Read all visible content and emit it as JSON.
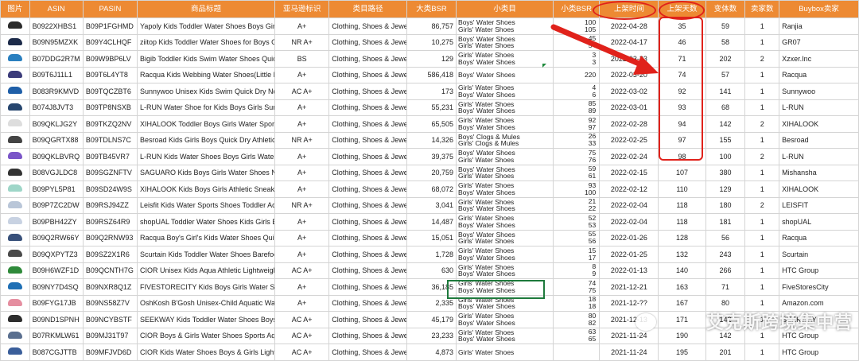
{
  "headers": [
    "图片",
    "ASIN",
    "PASIN",
    "商品标题",
    "亚马逊标识",
    "类目路径",
    "大类BSR",
    "小类目",
    "小类BSR",
    "上架时间",
    "上架天数",
    "变体数",
    "卖家数",
    "Buybox卖家"
  ],
  "colors": {
    "header_bg": "#ed8a33",
    "annotation_red": "#e0221b",
    "selection_green": "#1e7a3c"
  },
  "rows": [
    {
      "shoe": "#2b2b2b",
      "asin": "B0922XHBS1",
      "pasin": "B09P1FGHMD",
      "title": "Yapoly Kids Toddler Water Shoes Boys Girls Toddler",
      "badge": "A+",
      "cat": "Clothing, Shoes & Jewelry",
      "bsr": "86,757",
      "sub1": "Boys' Water Shoes",
      "sub2": "Girls' Water Shoes",
      "sbsr1": "100",
      "sbsr2": "105",
      "date": "2022-04-28",
      "days": "35",
      "var": "59",
      "sellers": "1",
      "buybox": "Ranjia"
    },
    {
      "shoe": "#1d2b4a",
      "asin": "B09N95MZXK",
      "pasin": "B09Y4CLHQF",
      "title": "ziitop Kids Toddler Water Shoes for Boys Girls",
      "badge": "NR A+",
      "cat": "Clothing, Shoes & Jewelry",
      "bsr": "10,275",
      "sub1": "Boys' Water Shoes",
      "sub2": "Girls' Water Shoes",
      "sbsr1": "45",
      "sbsr2": "54",
      "date": "2022-04-17",
      "days": "46",
      "var": "58",
      "sellers": "1",
      "buybox": "GR07"
    },
    {
      "shoe": "#2a7fbf",
      "asin": "B07DDG2R7M",
      "pasin": "B09W9BP6LV",
      "title": "Bigib Toddler Kids Swim Water Shoes Quick Dry",
      "badge": "BS",
      "cat": "Clothing, Shoes & Jewelry",
      "bsr": "129",
      "sub1": "Girls' Water Shoes",
      "sub2": "Boys' Water Shoes",
      "sbsr1": "3",
      "sbsr2": "3",
      "date": "2022-03-23",
      "days": "71",
      "var": "202",
      "sellers": "2",
      "buybox": "Xzxer.Inc"
    },
    {
      "shoe": "#3b3b7a",
      "asin": "B09T6J11L1",
      "pasin": "B09T6L4YT8",
      "title": "Racqua Kids Webbing Water Shoes(Little Kid/Big Kid)",
      "badge": "A+",
      "cat": "Clothing, Shoes & Jewelry",
      "bsr": "586,418",
      "sub1": "Boys' Water Shoes",
      "sub2": "",
      "sbsr1": "220",
      "sbsr2": "",
      "date": "2022-03-20",
      "days": "74",
      "var": "57",
      "sellers": "1",
      "buybox": "Racqua"
    },
    {
      "shoe": "#1f5fa8",
      "asin": "B083R9KMVD",
      "pasin": "B09TQCZBT6",
      "title": "Sunnywoo Unisex Kids Swim Quick Dry Non-Slip",
      "badge": "AC A+",
      "cat": "Clothing, Shoes & Jewelry",
      "bsr": "173",
      "sub1": "Girls' Water Shoes",
      "sub2": "Boys' Water Shoes",
      "sbsr1": "4",
      "sbsr2": "6",
      "date": "2022-03-02",
      "days": "92",
      "var": "141",
      "sellers": "1",
      "buybox": "Sunnywoo"
    },
    {
      "shoe": "#26456e",
      "asin": "B074J8JVT3",
      "pasin": "B09TP8NSXB",
      "title": "L-RUN Water Shoe for Kids Boys Girls Summer",
      "badge": "A+",
      "cat": "Clothing, Shoes & Jewelry",
      "bsr": "55,231",
      "sub1": "Girls' Water Shoes",
      "sub2": "Boys' Water Shoes",
      "sbsr1": "85",
      "sbsr2": "89",
      "date": "2022-03-01",
      "days": "93",
      "var": "68",
      "sellers": "1",
      "buybox": "L-RUN"
    },
    {
      "shoe": "#dddddd",
      "asin": "B09QKLJG2Y",
      "pasin": "B09TKZQ2NV",
      "title": "XIHALOOK Toddler Boys Girls Water Sport Shoes",
      "badge": "A+",
      "cat": "Clothing, Shoes & Jewelry",
      "bsr": "65,505",
      "sub1": "Girls' Water Shoes",
      "sub2": "Boys' Water Shoes",
      "sbsr1": "92",
      "sbsr2": "97",
      "date": "2022-02-28",
      "days": "94",
      "var": "142",
      "sellers": "2",
      "buybox": "XIHALOOK"
    },
    {
      "shoe": "#444444",
      "asin": "B09QGRTX88",
      "pasin": "B09TDLNS7C",
      "title": "Besroad Kids Girls Boys Quick Dry Athletic Shoes",
      "badge": "NR A+",
      "cat": "Clothing, Shoes & Jewelry",
      "bsr": "14,326",
      "sub1": "Boys' Clogs & Mules",
      "sub2": "Girls' Clogs & Mules",
      "sbsr1": "26",
      "sbsr2": "33",
      "date": "2022-02-25",
      "days": "97",
      "var": "155",
      "sellers": "1",
      "buybox": "Besroad"
    },
    {
      "shoe": "#7a55c8",
      "asin": "B09QKLBVRQ",
      "pasin": "B09TB45VR7",
      "title": "L-RUN Kids Water Shoes Boys Girls Water Barefoot",
      "badge": "A+",
      "cat": "Clothing, Shoes & Jewelry",
      "bsr": "39,375",
      "sub1": "Boys' Water Shoes",
      "sub2": "Girls' Water Shoes",
      "sbsr1": "75",
      "sbsr2": "76",
      "date": "2022-02-24",
      "days": "98",
      "var": "100",
      "sellers": "2",
      "buybox": "L-RUN"
    },
    {
      "shoe": "#333333",
      "asin": "B08VGJLDC8",
      "pasin": "B09SGZNFTV",
      "title": "SAGUARO Kids Boys Girls Water Shoes Non-Slip",
      "badge": "A+",
      "cat": "Clothing, Shoes & Jewelry",
      "bsr": "20,759",
      "sub1": "Boys' Water Shoes",
      "sub2": "Girls' Water Shoes",
      "sbsr1": "59",
      "sbsr2": "61",
      "date": "2022-02-15",
      "days": "107",
      "var": "380",
      "sellers": "1",
      "buybox": "Mishansha"
    },
    {
      "shoe": "#9ed6c8",
      "asin": "B09PYL5P81",
      "pasin": "B09SD24W9S",
      "title": "XIHALOOK Kids Boys Girls Athletic Sneakers Water",
      "badge": "A+",
      "cat": "Clothing, Shoes & Jewelry",
      "bsr": "68,072",
      "sub1": "Girls' Water Shoes",
      "sub2": "Boys' Water Shoes",
      "sbsr1": "93",
      "sbsr2": "100",
      "date": "2022-02-12",
      "days": "110",
      "var": "129",
      "sellers": "1",
      "buybox": "XIHALOOK"
    },
    {
      "shoe": "#b9c6d8",
      "asin": "B09P7ZC2DW",
      "pasin": "B09RSJ94ZZ",
      "title": "Leisfit Kids Water Sports Shoes Toddler Aqua",
      "badge": "NR A+",
      "cat": "Clothing, Shoes & Jewelry",
      "bsr": "3,041",
      "sub1": "Girls' Water Shoes",
      "sub2": "Boys' Water Shoes",
      "sbsr1": "21",
      "sbsr2": "22",
      "date": "2022-02-04",
      "days": "118",
      "var": "180",
      "sellers": "2",
      "buybox": "LEISFIT"
    },
    {
      "shoe": "#c8d2e2",
      "asin": "B09PBH42ZY",
      "pasin": "B09RSZ64R9",
      "title": "shopUAL Toddler Water Shoes Kids Girls Boys",
      "badge": "A+",
      "cat": "Clothing, Shoes & Jewelry",
      "bsr": "14,487",
      "sub1": "Girls' Water Shoes",
      "sub2": "Boys' Water Shoes",
      "sbsr1": "52",
      "sbsr2": "53",
      "date": "2022-02-04",
      "days": "118",
      "var": "181",
      "sellers": "1",
      "buybox": "shopUAL"
    },
    {
      "shoe": "#38507a",
      "asin": "B09Q2RW66Y",
      "pasin": "B09Q2RNW93",
      "title": "Racqua Boy's Girl's Kids Water Shoes Quick Dry",
      "badge": "A+",
      "cat": "Clothing, Shoes & Jewelry",
      "bsr": "15,051",
      "sub1": "Boys' Water Shoes",
      "sub2": "Girls' Water Shoes",
      "sbsr1": "55",
      "sbsr2": "56",
      "date": "2022-01-26",
      "days": "128",
      "var": "56",
      "sellers": "1",
      "buybox": "Racqua"
    },
    {
      "shoe": "#4a4a4a",
      "asin": "B09QXPYTZ3",
      "pasin": "B09SZ2X1R6",
      "title": "Scurtain Kids Toddler Water Shoes Barefoot Quick",
      "badge": "A+",
      "cat": "Clothing, Shoes & Jewelry",
      "bsr": "1,728",
      "sub1": "Girls' Water Shoes",
      "sub2": "Boys' Water Shoes",
      "sbsr1": "15",
      "sbsr2": "17",
      "date": "2022-01-25",
      "days": "132",
      "var": "243",
      "sellers": "1",
      "buybox": "Scurtain"
    },
    {
      "shoe": "#2f8a3a",
      "asin": "B09H6WZF1D",
      "pasin": "B09QCNTH7G",
      "title": "CIOR Unisex Kids Aqua Athletic Lightweight Water",
      "badge": "AC A+",
      "cat": "Clothing, Shoes & Jewelry",
      "bsr": "630",
      "sub1": "Girls' Water Shoes",
      "sub2": "Boys' Water Shoes",
      "sbsr1": "8",
      "sbsr2": "9",
      "date": "2022-01-13",
      "days": "140",
      "var": "266",
      "sellers": "1",
      "buybox": "HTC Group"
    },
    {
      "shoe": "#1e6fb5",
      "asin": "B09NY7D4SQ",
      "pasin": "B09NXR8Q1Z",
      "title": "FIVESTORECITY Kids Boys Girls Water Shoes Kids",
      "badge": "A+",
      "cat": "Clothing, Shoes & Jewelry",
      "bsr": "36,185",
      "sub1": "Girls' Water Shoes",
      "sub2": "Boys' Water Shoes",
      "sbsr1": "74",
      "sbsr2": "75",
      "date": "2021-12-21",
      "days": "163",
      "var": "71",
      "sellers": "1",
      "buybox": "FiveStoresCity"
    },
    {
      "shoe": "#e58ea0",
      "asin": "B09FYG17JB",
      "pasin": "B09NS58Z7V",
      "title": "OshKosh B'Gosh Unisex-Child Aquatic Water Shoe",
      "badge": "A+",
      "cat": "Clothing, Shoes & Jewelry",
      "bsr": "2,335",
      "sub1": "Girls' Water Shoes",
      "sub2": "Boys' Water Shoes",
      "sbsr1": "18",
      "sbsr2": "18",
      "date": "2021-12-??",
      "days": "167",
      "var": "80",
      "sellers": "1",
      "buybox": "Amazon.com"
    },
    {
      "shoe": "#2e2e2e",
      "asin": "B09ND1SPNH",
      "pasin": "B09NCYBSTF",
      "title": "SEEKWAY Kids Toddler Water Shoes Boys Girls",
      "badge": "AC A+",
      "cat": "Clothing, Shoes & Jewelry",
      "bsr": "45,179",
      "sub1": "Girls' Water Shoes",
      "sub2": "Boys' Water Shoes",
      "sbsr1": "80",
      "sbsr2": "82",
      "date": "2021-12-13",
      "days": "171",
      "var": "142",
      "sellers": "1",
      "buybox": "SEEKWAY"
    },
    {
      "shoe": "#5a6f8f",
      "asin": "B07RKMLW61",
      "pasin": "B09MJ31T97",
      "title": "CIOR Boys & Girls Water Shoes Sports Aqua Athletic",
      "badge": "AC A+",
      "cat": "Clothing, Shoes & Jewelry",
      "bsr": "23,233",
      "sub1": "Girls' Water Shoes",
      "sub2": "Boys' Water Shoes",
      "sbsr1": "63",
      "sbsr2": "65",
      "date": "2021-11-24",
      "days": "190",
      "var": "142",
      "sellers": "1",
      "buybox": "HTC Group"
    },
    {
      "shoe": "#3a5e9a",
      "asin": "B087CGJTTB",
      "pasin": "B09MFJVD6D",
      "title": "CIOR Kids Water Shoes Boys & Girls Lightweight",
      "badge": "AC A+",
      "cat": "Clothing, Shoes & Jewelry",
      "bsr": "4,873",
      "sub1": "Girls' Water Shoes",
      "sub2": "",
      "sbsr1": "",
      "sbsr2": "",
      "date": "2021-11-24",
      "days": "195",
      "var": "201",
      "sellers": "1",
      "buybox": "HTC Group"
    }
  ],
  "watermark": "艾克斯跨境集中营"
}
